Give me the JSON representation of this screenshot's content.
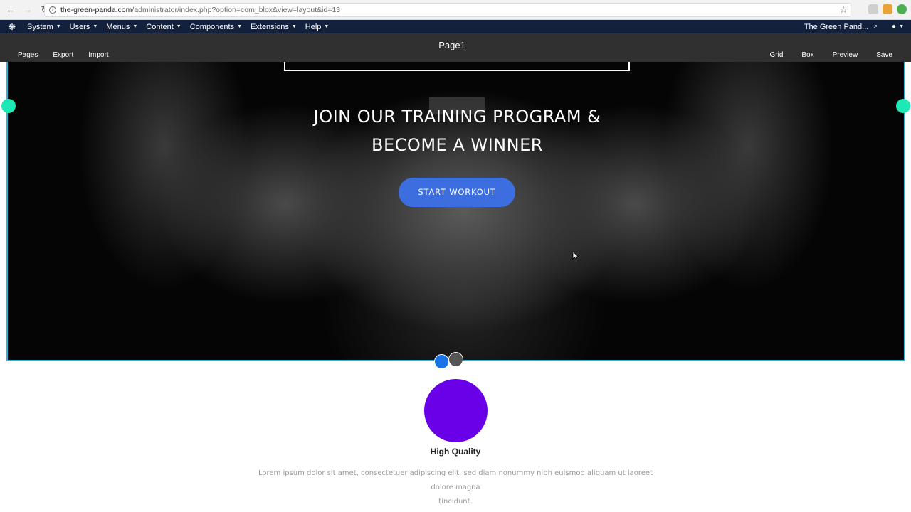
{
  "browser": {
    "url_domain": "the-green-panda.com",
    "url_path": "/administrator/index.php?option=com_blox&view=layout&id=13"
  },
  "admin_menu": {
    "items": [
      {
        "label": "System"
      },
      {
        "label": "Users"
      },
      {
        "label": "Menus"
      },
      {
        "label": "Content"
      },
      {
        "label": "Components"
      },
      {
        "label": "Extensions"
      },
      {
        "label": "Help"
      }
    ],
    "site_name": "The Green Pand..."
  },
  "builder": {
    "title": "Page1",
    "left_actions": [
      "Pages",
      "Export",
      "Import"
    ],
    "right_actions": [
      "Grid",
      "Box",
      "Preview",
      "Save"
    ]
  },
  "hero": {
    "heading_line1": "JOIN OUR TRAINING PROGRAM &",
    "heading_line2": "BECOME A WINNER",
    "button_label": "START WORKOUT"
  },
  "feature": {
    "title": "High Quality",
    "text_line1": "Lorem ipsum dolor sit amet, consectetuer adipiscing elit, sed diam nonummy nibh euismod aliquam ut laoreet dolore magna",
    "text_line2": "tincidunt."
  },
  "colors": {
    "admin_bar": "#14213d",
    "builder_bar": "#303030",
    "accent_button": "#3d6ee0",
    "handle": "#1de9b6",
    "feature_circle": "#6a00e8",
    "selection_border": "#29b6d8"
  },
  "icons": [
    "back-icon",
    "forward-icon",
    "reload-icon",
    "info-icon",
    "star-icon",
    "joomla-icon",
    "external-link-icon",
    "user-icon",
    "cursor-icon"
  ]
}
